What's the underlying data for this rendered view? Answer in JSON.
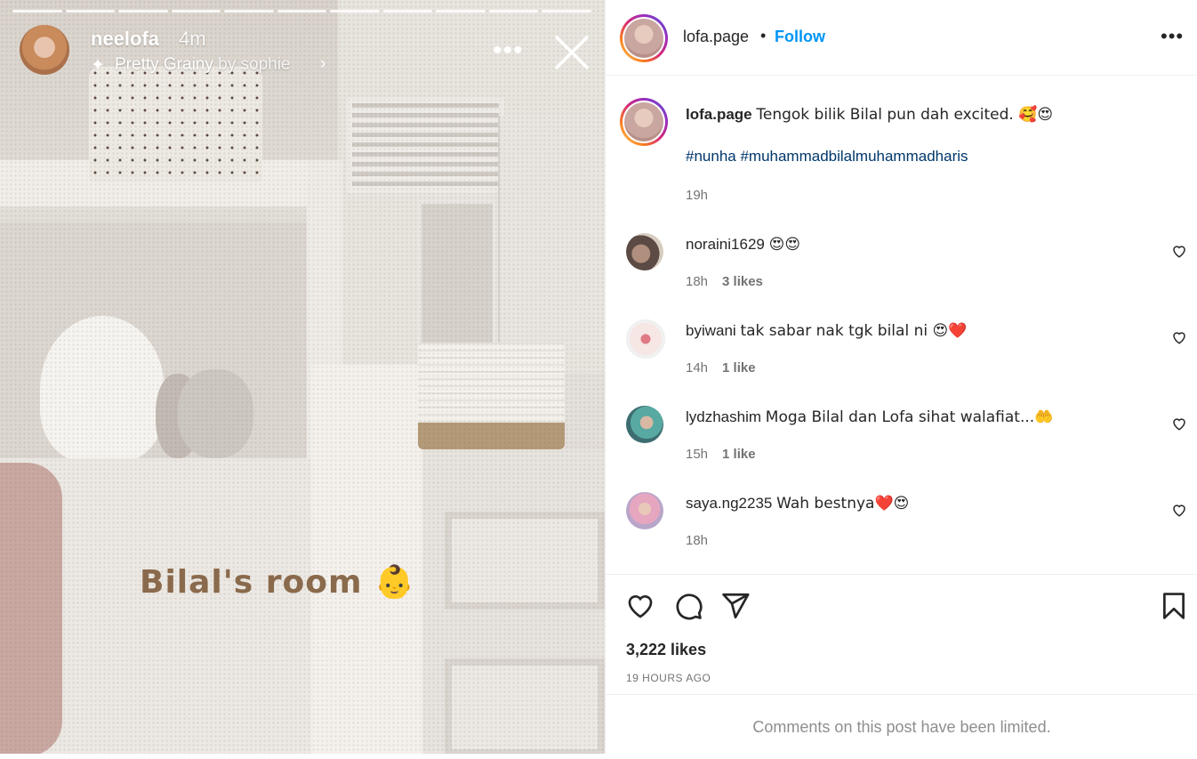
{
  "story": {
    "username": "neelofa",
    "time": "4m",
    "filter_name": "Pretty Grainy",
    "filter_by": "by sophie",
    "sticker_text": "Bilal's room 👶",
    "segments": 11
  },
  "post": {
    "header": {
      "username": "lofa.page",
      "separator": "•",
      "follow": "Follow"
    },
    "caption": {
      "username": "lofa.page",
      "text": "Tengok bilik Bilal pun dah excited. 🥰😍",
      "hashtags": "#nunha #muhammadbilalmuhammadharis",
      "time": "19h"
    },
    "comments": [
      {
        "username": "noraini1629",
        "text": "😍😍",
        "time": "18h",
        "likes": "3 likes"
      },
      {
        "username": "byiwani",
        "text": "tak sabar nak tgk bilal ni 😍❤️",
        "time": "14h",
        "likes": "1 like"
      },
      {
        "username": "lydzhashim",
        "text": "Moga Bilal dan Lofa sihat walafiat...🤲",
        "time": "15h",
        "likes": "1 like"
      },
      {
        "username": "saya.ng2235",
        "text": "Wah bestnya❤️😍",
        "time": "18h",
        "likes": ""
      }
    ],
    "likes": "3,222 likes",
    "time_ago": "19 HOURS AGO",
    "comments_limited": "Comments on this post have been limited."
  },
  "icons": {
    "story_more": "more-horizontal-icon",
    "story_close": "close-icon",
    "header_more": "more-horizontal-icon",
    "like": "heart-icon",
    "comment": "comment-icon",
    "share": "paper-plane-icon",
    "save": "bookmark-icon"
  },
  "colors": {
    "follow": "#0095f6",
    "hashtag": "#00376b",
    "muted": "#737373"
  }
}
